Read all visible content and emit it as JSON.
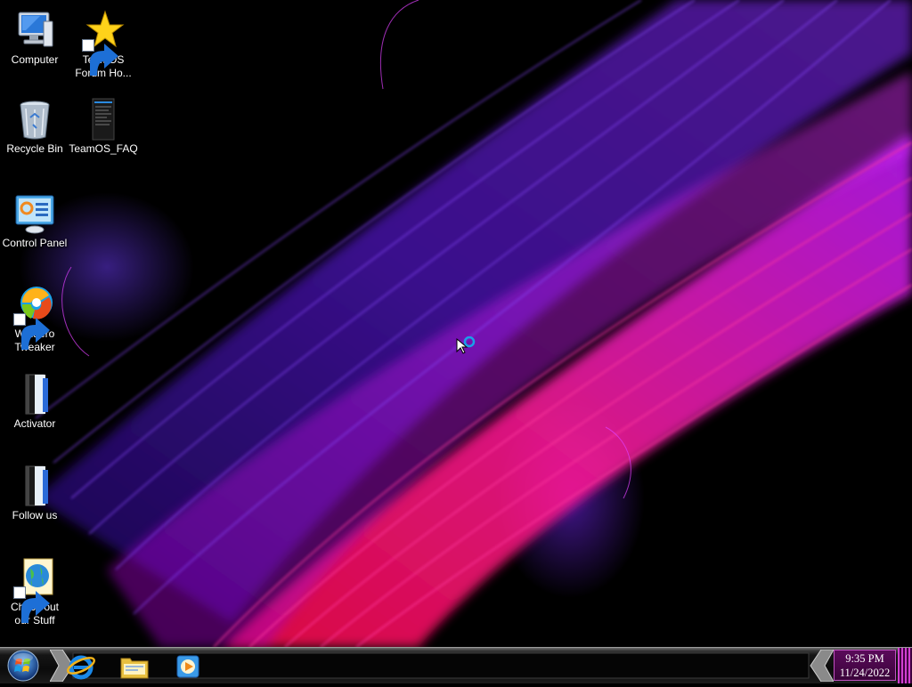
{
  "desktop": {
    "icons": [
      {
        "label_line1": "Computer",
        "label_line2": "",
        "icon": "computer-icon"
      },
      {
        "label_line1": "TeamOS",
        "label_line2": "Forum Ho...",
        "icon": "star-shortcut-icon"
      },
      {
        "label_line1": "Recycle Bin",
        "label_line2": "",
        "icon": "recycle-bin-icon"
      },
      {
        "label_line1": "TeamOS_FAQ",
        "label_line2": "",
        "icon": "document-icon"
      },
      {
        "label_line1": "Control Panel",
        "label_line2": "",
        "icon": "control-panel-icon"
      },
      {
        "label_line1": "Winaero",
        "label_line2": "Tweaker",
        "icon": "winaero-tweaker-icon"
      },
      {
        "label_line1": "Activator",
        "label_line2": "",
        "icon": "activator-icon"
      },
      {
        "label_line1": "Follow us",
        "label_line2": "",
        "icon": "follow-us-icon"
      },
      {
        "label_line1": "Check out",
        "label_line2": "our Stuff",
        "icon": "globe-shortcut-icon"
      }
    ]
  },
  "taskbar": {
    "start_button": "start-orb-icon",
    "pinned": [
      {
        "name": "Internet Explorer",
        "icon": "internet-explorer-icon"
      },
      {
        "name": "Windows Explorer",
        "icon": "folder-icon"
      },
      {
        "name": "Windows Media Player",
        "icon": "media-player-icon"
      }
    ],
    "clock": {
      "time": "9:35 PM",
      "date": "11/24/2022"
    }
  },
  "colors": {
    "accent_magenta": "#c050c0",
    "wallpaper_purple": "#6a1cff",
    "wallpaper_pink": "#ff1a7a"
  }
}
